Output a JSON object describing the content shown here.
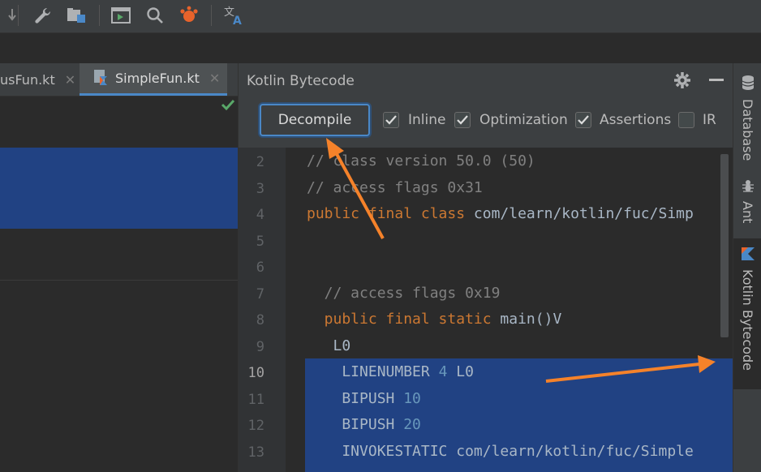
{
  "toolbar": {
    "icons": [
      "wrench-icon",
      "project-structure-icon",
      "run-anything-icon",
      "search-icon",
      "plugin-icon",
      "translate-icon"
    ]
  },
  "editor": {
    "tabs": [
      {
        "label": "usFun.kt",
        "active": false
      },
      {
        "label": "SimpleFun.kt",
        "active": true
      }
    ],
    "status_icon": "checkmark-icon"
  },
  "panel": {
    "title": "Kotlin Bytecode",
    "decompile_label": "Decompile",
    "options": [
      {
        "label": "Inline",
        "checked": true
      },
      {
        "label": "Optimization",
        "checked": true
      },
      {
        "label": "Assertions",
        "checked": true
      },
      {
        "label": "IR",
        "checked": false
      }
    ]
  },
  "code": {
    "line_numbers": [
      "2",
      "3",
      "4",
      "5",
      "6",
      "7",
      "8",
      "9",
      "10",
      "11",
      "12",
      "13"
    ],
    "current_line": "10",
    "lines": [
      [
        {
          "t": "// class version 50.0 (50)",
          "c": "comment"
        }
      ],
      [
        {
          "t": "// access flags 0x31",
          "c": "comment"
        }
      ],
      [
        {
          "t": "public final class ",
          "c": "keyword"
        },
        {
          "t": "com/learn/kotlin/fuc/Simp",
          "c": "text"
        }
      ],
      [],
      [],
      [
        {
          "t": "  // access flags 0x19",
          "c": "comment"
        }
      ],
      [
        {
          "t": "  public final static ",
          "c": "keyword"
        },
        {
          "t": "main()V",
          "c": "text"
        }
      ],
      [
        {
          "t": "   L0",
          "c": "text"
        }
      ],
      [
        {
          "t": "    LINENUMBER ",
          "c": "text"
        },
        {
          "t": "4",
          "c": "num"
        },
        {
          "t": " L0",
          "c": "text"
        }
      ],
      [
        {
          "t": "    BIPUSH ",
          "c": "text"
        },
        {
          "t": "10",
          "c": "num"
        }
      ],
      [
        {
          "t": "    BIPUSH ",
          "c": "text"
        },
        {
          "t": "20",
          "c": "num"
        }
      ],
      [
        {
          "t": "    INVOKESTATIC com/learn/kotlin/fuc/Simple",
          "c": "text"
        }
      ]
    ]
  },
  "side_tabs": [
    {
      "label": "Database",
      "icon": "database-icon"
    },
    {
      "label": "Ant",
      "icon": "ant-icon"
    },
    {
      "label": "Kotlin Bytecode",
      "icon": "kotlin-icon"
    }
  ],
  "colors": {
    "selection": "#214283",
    "accent": "#4a88c7",
    "annotation_arrow": "#f5822a"
  }
}
